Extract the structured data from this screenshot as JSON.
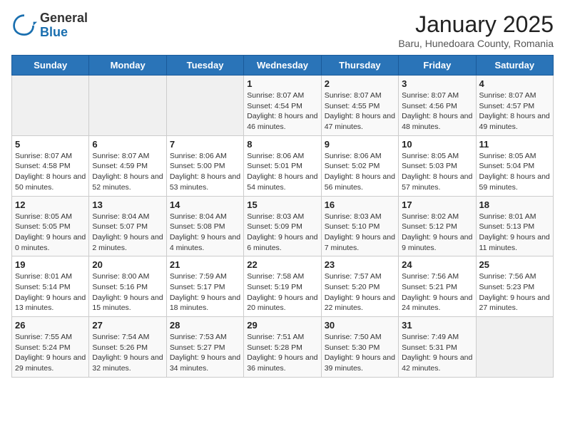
{
  "header": {
    "logo_general": "General",
    "logo_blue": "Blue",
    "title": "January 2025",
    "subtitle": "Baru, Hunedoara County, Romania"
  },
  "weekdays": [
    "Sunday",
    "Monday",
    "Tuesday",
    "Wednesday",
    "Thursday",
    "Friday",
    "Saturday"
  ],
  "weeks": [
    [
      {
        "day": "",
        "info": ""
      },
      {
        "day": "",
        "info": ""
      },
      {
        "day": "",
        "info": ""
      },
      {
        "day": "1",
        "info": "Sunrise: 8:07 AM\nSunset: 4:54 PM\nDaylight: 8 hours and 46 minutes."
      },
      {
        "day": "2",
        "info": "Sunrise: 8:07 AM\nSunset: 4:55 PM\nDaylight: 8 hours and 47 minutes."
      },
      {
        "day": "3",
        "info": "Sunrise: 8:07 AM\nSunset: 4:56 PM\nDaylight: 8 hours and 48 minutes."
      },
      {
        "day": "4",
        "info": "Sunrise: 8:07 AM\nSunset: 4:57 PM\nDaylight: 8 hours and 49 minutes."
      }
    ],
    [
      {
        "day": "5",
        "info": "Sunrise: 8:07 AM\nSunset: 4:58 PM\nDaylight: 8 hours and 50 minutes."
      },
      {
        "day": "6",
        "info": "Sunrise: 8:07 AM\nSunset: 4:59 PM\nDaylight: 8 hours and 52 minutes."
      },
      {
        "day": "7",
        "info": "Sunrise: 8:06 AM\nSunset: 5:00 PM\nDaylight: 8 hours and 53 minutes."
      },
      {
        "day": "8",
        "info": "Sunrise: 8:06 AM\nSunset: 5:01 PM\nDaylight: 8 hours and 54 minutes."
      },
      {
        "day": "9",
        "info": "Sunrise: 8:06 AM\nSunset: 5:02 PM\nDaylight: 8 hours and 56 minutes."
      },
      {
        "day": "10",
        "info": "Sunrise: 8:05 AM\nSunset: 5:03 PM\nDaylight: 8 hours and 57 minutes."
      },
      {
        "day": "11",
        "info": "Sunrise: 8:05 AM\nSunset: 5:04 PM\nDaylight: 8 hours and 59 minutes."
      }
    ],
    [
      {
        "day": "12",
        "info": "Sunrise: 8:05 AM\nSunset: 5:05 PM\nDaylight: 9 hours and 0 minutes."
      },
      {
        "day": "13",
        "info": "Sunrise: 8:04 AM\nSunset: 5:07 PM\nDaylight: 9 hours and 2 minutes."
      },
      {
        "day": "14",
        "info": "Sunrise: 8:04 AM\nSunset: 5:08 PM\nDaylight: 9 hours and 4 minutes."
      },
      {
        "day": "15",
        "info": "Sunrise: 8:03 AM\nSunset: 5:09 PM\nDaylight: 9 hours and 6 minutes."
      },
      {
        "day": "16",
        "info": "Sunrise: 8:03 AM\nSunset: 5:10 PM\nDaylight: 9 hours and 7 minutes."
      },
      {
        "day": "17",
        "info": "Sunrise: 8:02 AM\nSunset: 5:12 PM\nDaylight: 9 hours and 9 minutes."
      },
      {
        "day": "18",
        "info": "Sunrise: 8:01 AM\nSunset: 5:13 PM\nDaylight: 9 hours and 11 minutes."
      }
    ],
    [
      {
        "day": "19",
        "info": "Sunrise: 8:01 AM\nSunset: 5:14 PM\nDaylight: 9 hours and 13 minutes."
      },
      {
        "day": "20",
        "info": "Sunrise: 8:00 AM\nSunset: 5:16 PM\nDaylight: 9 hours and 15 minutes."
      },
      {
        "day": "21",
        "info": "Sunrise: 7:59 AM\nSunset: 5:17 PM\nDaylight: 9 hours and 18 minutes."
      },
      {
        "day": "22",
        "info": "Sunrise: 7:58 AM\nSunset: 5:19 PM\nDaylight: 9 hours and 20 minutes."
      },
      {
        "day": "23",
        "info": "Sunrise: 7:57 AM\nSunset: 5:20 PM\nDaylight: 9 hours and 22 minutes."
      },
      {
        "day": "24",
        "info": "Sunrise: 7:56 AM\nSunset: 5:21 PM\nDaylight: 9 hours and 24 minutes."
      },
      {
        "day": "25",
        "info": "Sunrise: 7:56 AM\nSunset: 5:23 PM\nDaylight: 9 hours and 27 minutes."
      }
    ],
    [
      {
        "day": "26",
        "info": "Sunrise: 7:55 AM\nSunset: 5:24 PM\nDaylight: 9 hours and 29 minutes."
      },
      {
        "day": "27",
        "info": "Sunrise: 7:54 AM\nSunset: 5:26 PM\nDaylight: 9 hours and 32 minutes."
      },
      {
        "day": "28",
        "info": "Sunrise: 7:53 AM\nSunset: 5:27 PM\nDaylight: 9 hours and 34 minutes."
      },
      {
        "day": "29",
        "info": "Sunrise: 7:51 AM\nSunset: 5:28 PM\nDaylight: 9 hours and 36 minutes."
      },
      {
        "day": "30",
        "info": "Sunrise: 7:50 AM\nSunset: 5:30 PM\nDaylight: 9 hours and 39 minutes."
      },
      {
        "day": "31",
        "info": "Sunrise: 7:49 AM\nSunset: 5:31 PM\nDaylight: 9 hours and 42 minutes."
      },
      {
        "day": "",
        "info": ""
      }
    ]
  ]
}
